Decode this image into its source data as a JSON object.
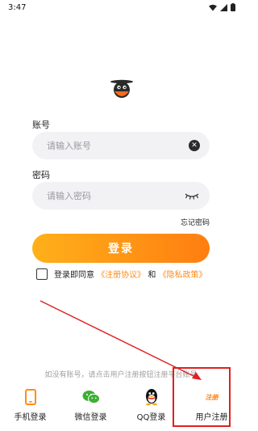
{
  "status_bar": {
    "time": "3:47",
    "icons": [
      "wifi-icon",
      "signal-icon",
      "battery-icon"
    ]
  },
  "logo": {
    "icon": "mascot-logo-icon"
  },
  "account": {
    "label": "账号",
    "placeholder": "请输入账号",
    "value": "",
    "clear_icon": "clear-circle-icon"
  },
  "password": {
    "label": "密码",
    "placeholder": "请输入密码",
    "value": "",
    "toggle_icon": "eye-closed-icon"
  },
  "forgot_password": "忘记密码",
  "login_button": "登录",
  "agreement": {
    "prefix": "登录即同意",
    "user_agreement": "《注册协议》",
    "and": "和",
    "privacy_policy": "《隐私政策》",
    "checked": false
  },
  "hint": "如没有账号，请点击用户注册按钮注册平台账号",
  "bottom_nav": {
    "items": [
      {
        "label": "手机登录",
        "icon": "phone-icon"
      },
      {
        "label": "微信登录",
        "icon": "wechat-icon"
      },
      {
        "label": "QQ登录",
        "icon": "qq-penguin-icon"
      },
      {
        "label": "用户注册",
        "icon": "register-icon",
        "icon_text": "注册"
      }
    ]
  },
  "colors": {
    "accent_start": "#ffb01a",
    "accent_end": "#ff7e10",
    "link": "#ff8c1a",
    "annotation": "#e02020",
    "field_bg": "#f2f2f4"
  }
}
